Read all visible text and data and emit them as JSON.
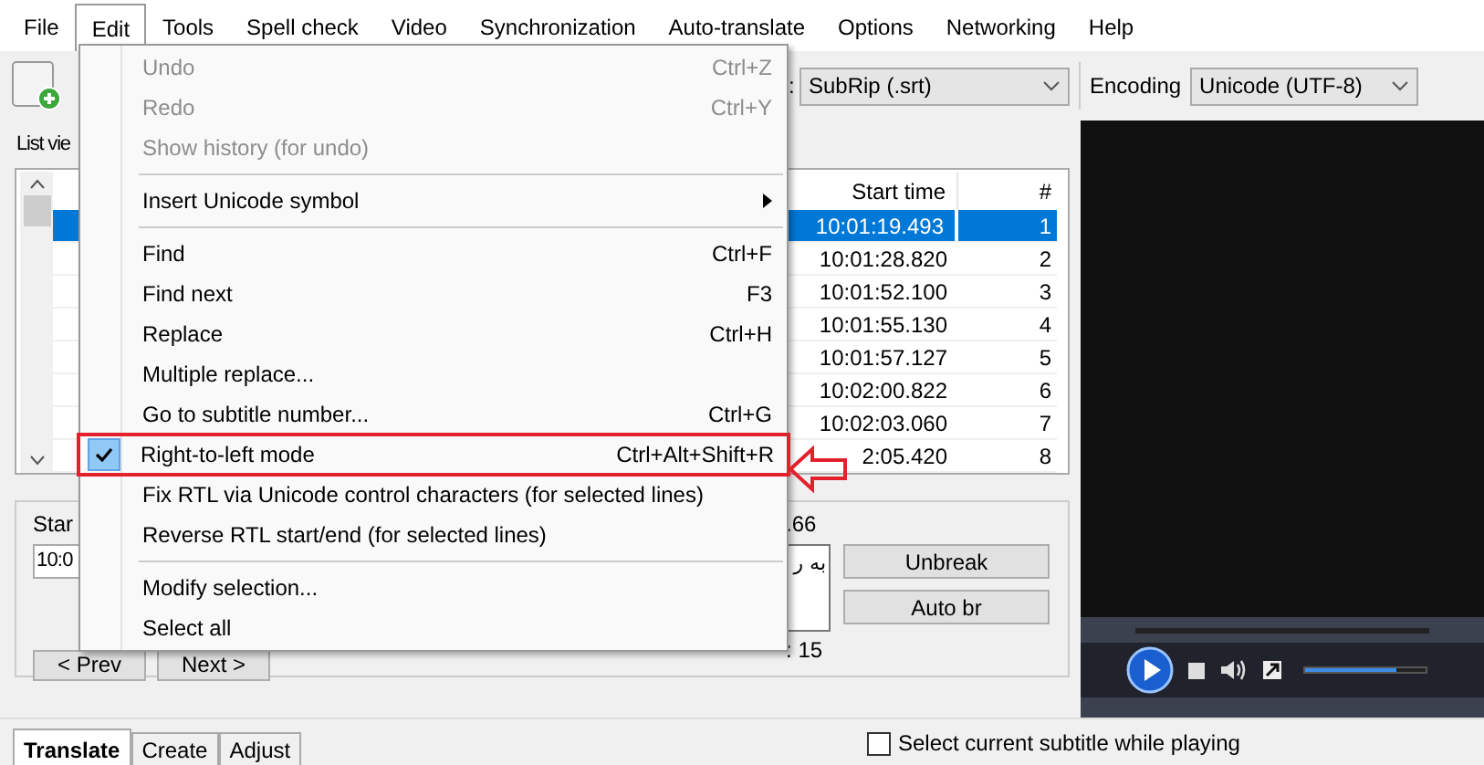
{
  "menubar": [
    {
      "label": "File",
      "selected": false
    },
    {
      "label": "Edit",
      "selected": true
    },
    {
      "label": "Tools",
      "selected": false
    },
    {
      "label": "Spell check",
      "selected": false
    },
    {
      "label": "Video",
      "selected": false
    },
    {
      "label": "Synchronization",
      "selected": false
    },
    {
      "label": "Auto-translate",
      "selected": false
    },
    {
      "label": "Options",
      "selected": false
    },
    {
      "label": "Networking",
      "selected": false
    },
    {
      "label": "Help",
      "selected": false
    }
  ],
  "edit_menu": [
    {
      "kind": "item",
      "label": "Undo",
      "shortcut": "Ctrl+Z",
      "disabled": true,
      "checked": false
    },
    {
      "kind": "item",
      "label": "Redo",
      "shortcut": "Ctrl+Y",
      "disabled": true,
      "checked": false
    },
    {
      "kind": "item",
      "label": "Show history (for undo)",
      "disabled": true,
      "checked": false
    },
    {
      "kind": "separator"
    },
    {
      "kind": "submenu",
      "label": "Insert Unicode symbol",
      "disabled": false,
      "checked": false
    },
    {
      "kind": "separator"
    },
    {
      "kind": "item",
      "label": "Find",
      "shortcut": "Ctrl+F",
      "disabled": false,
      "checked": false
    },
    {
      "kind": "item",
      "label": "Find next",
      "shortcut": "F3",
      "disabled": false,
      "checked": false
    },
    {
      "kind": "item",
      "label": "Replace",
      "shortcut": "Ctrl+H",
      "disabled": false,
      "checked": false
    },
    {
      "kind": "item",
      "label": "Multiple replace...",
      "disabled": false,
      "checked": false
    },
    {
      "kind": "item",
      "label": "Go to subtitle number...",
      "shortcut": "Ctrl+G",
      "disabled": false,
      "checked": false
    },
    {
      "kind": "item",
      "label": "Right-to-left mode",
      "shortcut": "Ctrl+Alt+Shift+R",
      "disabled": false,
      "checked": true,
      "highlighted": true
    },
    {
      "kind": "item",
      "label": "Fix RTL via Unicode control characters (for selected lines)",
      "disabled": false,
      "checked": false
    },
    {
      "kind": "item",
      "label": "Reverse RTL start/end (for selected lines)",
      "disabled": false,
      "checked": false
    },
    {
      "kind": "separator"
    },
    {
      "kind": "item",
      "label": "Modify selection...",
      "disabled": false,
      "checked": false
    },
    {
      "kind": "item",
      "label": "Select all",
      "disabled": false,
      "checked": false
    }
  ],
  "toolbar": {
    "format_colon": ":",
    "format": "SubRip (.srt)",
    "encoding_label": "Encoding",
    "encoding": "Unicode (UTF-8)"
  },
  "list_view": {
    "label": "List vie",
    "columns": [
      "Start time",
      "#"
    ],
    "rows": [
      {
        "start": "10:01:19.493",
        "number": "1",
        "selected": true
      },
      {
        "start": "10:01:28.820",
        "number": "2",
        "selected": false
      },
      {
        "start": "10:01:52.100",
        "number": "3",
        "selected": false
      },
      {
        "start": "10:01:55.130",
        "number": "4",
        "selected": false
      },
      {
        "start": "10:01:57.127",
        "number": "5",
        "selected": false
      },
      {
        "start": "10:02:00.822",
        "number": "6",
        "selected": false
      },
      {
        "start": "10:02:03.060",
        "number": "7",
        "selected": false
      },
      {
        "start": "2:05.420",
        "number": "8",
        "selected": false
      }
    ]
  },
  "edit_panel": {
    "start_label": "Star",
    "start_value": "10:0",
    "duration_tail": ".66",
    "text": "به ر",
    "buttons": [
      "Unbreak",
      "Auto br"
    ],
    "prev": "< Prev",
    "next": "Next >",
    "total_tail": ": 15"
  },
  "bottom_tabs": [
    {
      "label": "Translate",
      "selected": true
    },
    {
      "label": "Create",
      "selected": false
    },
    {
      "label": "Adjust",
      "selected": false
    }
  ],
  "select_while_playing": {
    "label": "Select current subtitle while playing",
    "checked": false
  },
  "video": {
    "volume": {
      "level": 0.75
    }
  }
}
